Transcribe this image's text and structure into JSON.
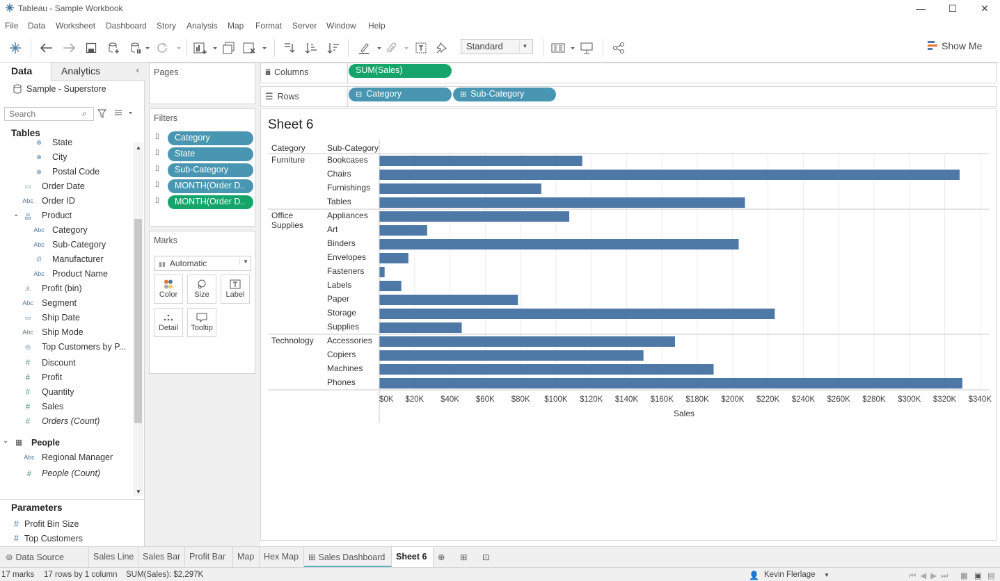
{
  "window": {
    "title": "Tableau - Sample Workbook"
  },
  "menu": [
    "File",
    "Data",
    "Worksheet",
    "Dashboard",
    "Story",
    "Analysis",
    "Map",
    "Format",
    "Server",
    "Window",
    "Help"
  ],
  "toolbar": {
    "fit_select": "Standard",
    "show_me": "Show Me"
  },
  "data_pane": {
    "tab_data": "Data",
    "tab_analytics": "Analytics",
    "datasource": "Sample - Superstore",
    "search_placeholder": "Search",
    "tables_header": "Tables",
    "fields": [
      {
        "label": "State",
        "icon": "globe-icon",
        "indent": 2,
        "italic": false
      },
      {
        "label": "City",
        "icon": "globe-icon",
        "indent": 2,
        "italic": false
      },
      {
        "label": "Postal Code",
        "icon": "globe-icon",
        "indent": 2,
        "italic": false
      },
      {
        "label": "Order Date",
        "icon": "calendar-icon",
        "indent": 1,
        "italic": false
      },
      {
        "label": "Order ID",
        "icon": "abc-icon",
        "indent": 1,
        "italic": false
      },
      {
        "label": "Product",
        "icon": "hierarchy-icon",
        "indent": 1,
        "italic": false
      },
      {
        "label": "Category",
        "icon": "abc-icon",
        "indent": 2,
        "italic": false
      },
      {
        "label": "Sub-Category",
        "icon": "abc-icon",
        "indent": 2,
        "italic": false
      },
      {
        "label": "Manufacturer",
        "icon": "paperclip-icon",
        "indent": 2,
        "italic": false
      },
      {
        "label": "Product Name",
        "icon": "abc-icon",
        "indent": 2,
        "italic": false
      },
      {
        "label": "Profit (bin)",
        "icon": "bin-icon",
        "indent": 1,
        "italic": false
      },
      {
        "label": "Segment",
        "icon": "abc-icon",
        "indent": 1,
        "italic": false
      },
      {
        "label": "Ship Date",
        "icon": "calendar-icon",
        "indent": 1,
        "italic": false
      },
      {
        "label": "Ship Mode",
        "icon": "abc-icon",
        "indent": 1,
        "italic": false
      },
      {
        "label": "Top Customers by P...",
        "icon": "set-icon",
        "indent": 1,
        "italic": false
      },
      {
        "label": "Discount",
        "icon": "hash-icon",
        "indent": 1,
        "italic": false
      },
      {
        "label": "Profit",
        "icon": "hash-icon",
        "indent": 1,
        "italic": false
      },
      {
        "label": "Quantity",
        "icon": "hash-icon",
        "indent": 1,
        "italic": false
      },
      {
        "label": "Sales",
        "icon": "hash-icon",
        "indent": 1,
        "italic": false
      },
      {
        "label": "Orders (Count)",
        "icon": "hash-icon",
        "indent": 1,
        "italic": true
      }
    ],
    "people_header": "People",
    "people_fields": [
      {
        "label": "Regional Manager",
        "icon": "abc-icon",
        "italic": false
      },
      {
        "label": "People (Count)",
        "icon": "hash-icon",
        "italic": true
      }
    ],
    "parameters_header": "Parameters",
    "parameters": [
      "Profit Bin Size",
      "Top Customers"
    ]
  },
  "pages": {
    "header": "Pages"
  },
  "filters": {
    "header": "Filters",
    "items": [
      "Category",
      "State",
      "Sub-Category",
      "MONTH(Order D..",
      "MONTH(Order D.."
    ]
  },
  "marks": {
    "header": "Marks",
    "type": "Automatic",
    "buttons": [
      "Color",
      "Size",
      "Label",
      "Detail",
      "Tooltip"
    ]
  },
  "columns_shelf": {
    "label": "Columns",
    "pills": [
      "SUM(Sales)"
    ]
  },
  "rows_shelf": {
    "label": "Rows",
    "pills": [
      "Category",
      "Sub-Category"
    ]
  },
  "sheet": {
    "title": "Sheet 6"
  },
  "chart_data": {
    "type": "bar",
    "orientation": "horizontal",
    "row_headers": [
      "Category",
      "Sub-Category"
    ],
    "groups": [
      {
        "category": "Furniture",
        "items": [
          {
            "sub": "Bookcases",
            "value": 114880
          },
          {
            "sub": "Chairs",
            "value": 328449
          },
          {
            "sub": "Furnishings",
            "value": 91705
          },
          {
            "sub": "Tables",
            "value": 206966
          }
        ]
      },
      {
        "category": "Office Supplies",
        "items": [
          {
            "sub": "Appliances",
            "value": 107532
          },
          {
            "sub": "Art",
            "value": 27119
          },
          {
            "sub": "Binders",
            "value": 203413
          },
          {
            "sub": "Envelopes",
            "value": 16476
          },
          {
            "sub": "Fasteners",
            "value": 3024
          },
          {
            "sub": "Labels",
            "value": 12486
          },
          {
            "sub": "Paper",
            "value": 78479
          },
          {
            "sub": "Storage",
            "value": 223844
          },
          {
            "sub": "Supplies",
            "value": 46674
          }
        ]
      },
      {
        "category": "Technology",
        "items": [
          {
            "sub": "Accessories",
            "value": 167380
          },
          {
            "sub": "Copiers",
            "value": 149528
          },
          {
            "sub": "Machines",
            "value": 189239
          },
          {
            "sub": "Phones",
            "value": 330007
          }
        ]
      }
    ],
    "xlabel": "Sales",
    "xlim": [
      0,
      345000
    ],
    "ticks": [
      0,
      20000,
      40000,
      60000,
      80000,
      100000,
      120000,
      140000,
      160000,
      180000,
      200000,
      220000,
      240000,
      260000,
      280000,
      300000,
      320000,
      340000
    ],
    "tick_labels": [
      "$0K",
      "$20K",
      "$40K",
      "$60K",
      "$80K",
      "$100K",
      "$120K",
      "$140K",
      "$160K",
      "$180K",
      "$200K",
      "$220K",
      "$240K",
      "$260K",
      "$280K",
      "$300K",
      "$320K",
      "$340K"
    ],
    "bar_color": "#4e79a7",
    "grid": true
  },
  "sheet_tabs": [
    "Data Source",
    "Sales Line",
    "Sales Bar",
    "Profit Bar",
    "Map",
    "Hex Map",
    "Sales Dashboard",
    "Sheet 6"
  ],
  "status": {
    "marks": "17 marks",
    "rows": "17 rows by 1 column",
    "sum": "SUM(Sales): $2,297K",
    "user": "Kevin Flerlage"
  }
}
